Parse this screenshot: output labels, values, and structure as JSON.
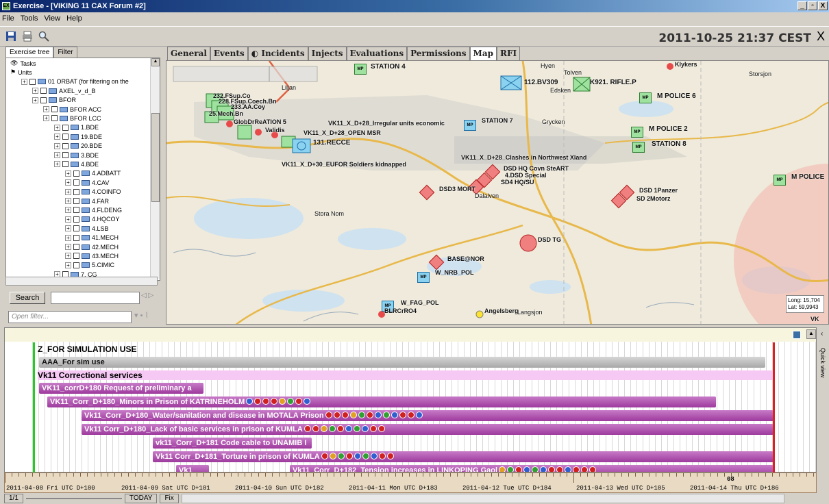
{
  "window": {
    "title": "Exercise - [VIKING 11 CAX Forum #2]",
    "minimize": "_",
    "restore": "×",
    "close": "X"
  },
  "menu": [
    "File",
    "Tools",
    "View",
    "Help"
  ],
  "toolbar": {
    "datetime": "2011-10-25 21:37 CEST",
    "close": "X"
  },
  "left": {
    "tabs": [
      "Exercise tree",
      "Filter"
    ],
    "tree": [
      {
        "label": "Tasks",
        "indent": 0,
        "kind": "tasks"
      },
      {
        "label": "Units",
        "indent": 0,
        "kind": "units"
      },
      {
        "label": "01 ORBAT (for filtering on the",
        "indent": 1,
        "kind": "unit"
      },
      {
        "label": "AXEL_v_d_B",
        "indent": 2,
        "kind": "unit"
      },
      {
        "label": "BFOR",
        "indent": 2,
        "kind": "unit"
      },
      {
        "label": "BFOR ACC",
        "indent": 3,
        "kind": "unit"
      },
      {
        "label": "BFOR LCC",
        "indent": 3,
        "kind": "unit"
      },
      {
        "label": "1.BDE",
        "indent": 4,
        "kind": "unit"
      },
      {
        "label": "19.BDE",
        "indent": 4,
        "kind": "unit"
      },
      {
        "label": "20.BDE",
        "indent": 4,
        "kind": "unit"
      },
      {
        "label": "3.BDE",
        "indent": 4,
        "kind": "unit"
      },
      {
        "label": "4.BDE",
        "indent": 4,
        "kind": "unit"
      },
      {
        "label": "4.ADBATT",
        "indent": 5,
        "kind": "unit"
      },
      {
        "label": "4.CAV",
        "indent": 5,
        "kind": "unit"
      },
      {
        "label": "4.COINFO",
        "indent": 5,
        "kind": "unit"
      },
      {
        "label": "4.FAR",
        "indent": 5,
        "kind": "unit"
      },
      {
        "label": "4.FLDENG",
        "indent": 5,
        "kind": "unit"
      },
      {
        "label": "4.HQCOY",
        "indent": 5,
        "kind": "unit"
      },
      {
        "label": "4.LSB",
        "indent": 5,
        "kind": "unit"
      },
      {
        "label": "41.MECH",
        "indent": 5,
        "kind": "unit"
      },
      {
        "label": "42.MECH",
        "indent": 5,
        "kind": "unit"
      },
      {
        "label": "43.MECH",
        "indent": 5,
        "kind": "unit"
      },
      {
        "label": "5.CIMIC",
        "indent": 5,
        "kind": "unit"
      },
      {
        "label": "7. CG",
        "indent": 4,
        "kind": "unit"
      }
    ],
    "search_label": "Search",
    "filter_placeholder": "Open filter..."
  },
  "tabs": [
    "General",
    "Events",
    "Incidents",
    "Injects",
    "Evaluations",
    "Permissions",
    "Map",
    "RFI"
  ],
  "map": {
    "labels": [
      {
        "t": "STATION 4"
      },
      {
        "t": "Hyen"
      },
      {
        "t": "Tolven"
      },
      {
        "t": "Klykers"
      },
      {
        "t": "Storsjon"
      },
      {
        "t": "Liljan"
      },
      {
        "t": "112.BV309"
      },
      {
        "t": "Edsken"
      },
      {
        "t": "K921. RIFLE.P"
      },
      {
        "t": "M POLICE 6"
      },
      {
        "t": "232.FSup.Co"
      },
      {
        "t": "228.FSup.Coech.Bn"
      },
      {
        "t": "233.AA.Coy"
      },
      {
        "t": "25.Mech.Bn"
      },
      {
        "t": "GlobDrReATION 5"
      },
      {
        "t": "Validis"
      },
      {
        "t": "VK11_X_D+28_Irregular units economic"
      },
      {
        "t": "STATION 7"
      },
      {
        "t": "Grycken"
      },
      {
        "t": "M POLICE 2"
      },
      {
        "t": "VK11_X_D+28_OPEN MSR"
      },
      {
        "t": "131.RECCE"
      },
      {
        "t": "STATION 8"
      },
      {
        "t": "VK11_X_D+28_Clashes in Northwest Xland"
      },
      {
        "t": "VK11_X_D+30_EUFOR Soldiers kidnapped"
      },
      {
        "t": "DSD HQ Covn SteART"
      },
      {
        "t": "4.DSD Special"
      },
      {
        "t": "SD4 HQ/SU"
      },
      {
        "t": "M POLICE"
      },
      {
        "t": "DSD3 MORT"
      },
      {
        "t": "Dalalven"
      },
      {
        "t": "DSD 1Panzer"
      },
      {
        "t": "SD 2Motorz"
      },
      {
        "t": "Stora Nom"
      },
      {
        "t": "DSD TG"
      },
      {
        "t": "BASE@NOR"
      },
      {
        "t": "W_NRB_POL"
      },
      {
        "t": "W_FAG_POL"
      },
      {
        "t": "BLRCrRO4"
      },
      {
        "t": "Angelsberg"
      },
      {
        "t": "Langsjon"
      },
      {
        "t": "VK"
      }
    ],
    "coords": {
      "long": "Long: 15,704",
      "lat": "Lat: 59,9943"
    },
    "mp_label": "MP"
  },
  "gantt": {
    "group1": "Z_FOR SIMULATION USE",
    "bar_aaa": "AAA_For sim use",
    "group2": "Vk11 Correctional services",
    "bars": [
      "VK11_corrD+180 Request of preliminary a",
      "VK11_Corr_D+180_Minors in Prison of KATRINEHOLM",
      "Vk11_Corr_D+180_Water/sanitation and disease in MOTALA Prison",
      "Vk11 Corr_D+180_Lack of basic services in prison of KUMLA",
      "vk11_Corr_D+181 Code cable to UNAMIB I",
      "Vk11 Corr_D+181_Torture in prison of KUMLA",
      "Vk1",
      "Vk11_Corr_D+182_Tension increases in LINKOPING Gaol"
    ]
  },
  "timeline": {
    "days": [
      "2011-04-08 Fri UTC D+180",
      "2011-04-09 Sat UTC D+181",
      "2011-04-10 Sun UTC D+182",
      "2011-04-11 Mon UTC D+183",
      "2011-04-12 Tue UTC D+184",
      "2011-04-13 Wed UTC D+185",
      "2011-04-14 Thu UTC D+186"
    ],
    "marker": "08"
  },
  "status": {
    "page": "1/1",
    "today": "TODAY",
    "fix": "Fix"
  },
  "quickview": "Quick view"
}
